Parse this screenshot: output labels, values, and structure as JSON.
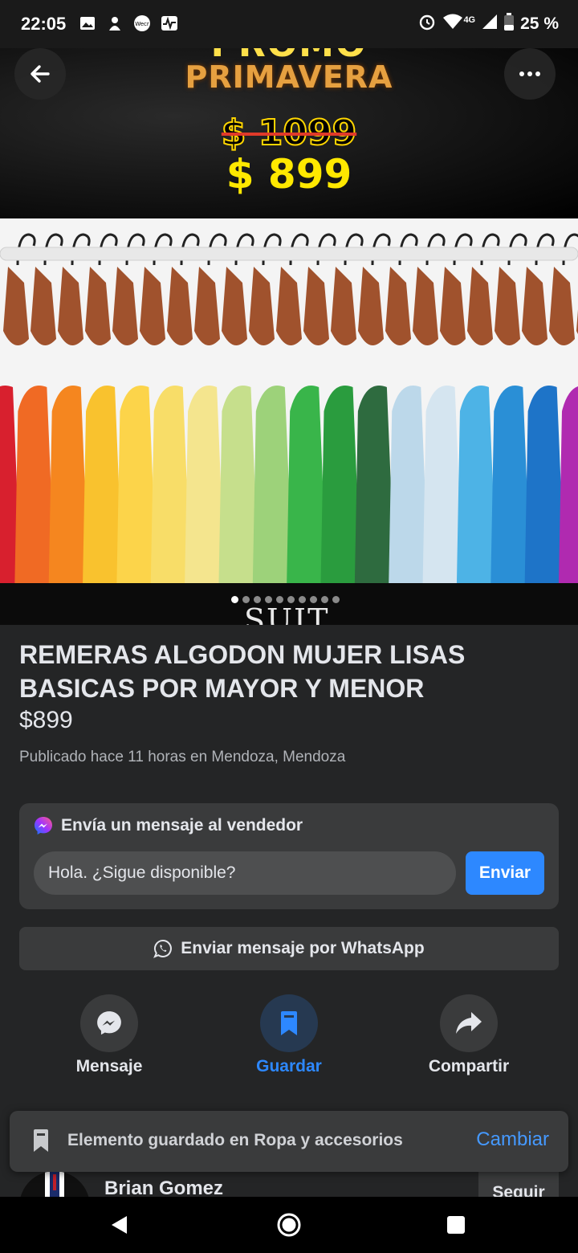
{
  "status_bar": {
    "time": "22:05",
    "network": "4G",
    "battery": "25 %",
    "icons": [
      "gallery-icon",
      "app-icon",
      "wecr-icon",
      "activity-icon",
      "alarm-icon",
      "wifi-icon",
      "signal-icon",
      "battery-icon"
    ]
  },
  "hero": {
    "promo_top": "PROMO",
    "promo_main": "PRIMAVERA",
    "old_price": "$ 1099",
    "new_price": "$ 899"
  },
  "gallery": {
    "dots_total": 10,
    "active_index": 0,
    "next_image_text": "SUIT"
  },
  "listing": {
    "title": "REMERAS ALGODON MUJER LISAS BASICAS POR MAYOR Y MENOR",
    "price": "$899",
    "meta": "Publicado hace 11 horas en Mendoza, Mendoza"
  },
  "message_card": {
    "header": "Envía un mensaje al vendedor",
    "input_value": "Hola. ¿Sigue disponible?",
    "send_label": "Enviar"
  },
  "whatsapp": {
    "label": "Enviar mensaje por WhatsApp"
  },
  "actions": [
    {
      "label": "Mensaje",
      "icon": "messenger-icon",
      "active": false
    },
    {
      "label": "Guardar",
      "icon": "bookmark-icon",
      "active": true
    },
    {
      "label": "Compartir",
      "icon": "share-icon",
      "active": false
    }
  ],
  "toast": {
    "text": "Elemento guardado en Ropa y accesorios",
    "action": "Cambiar"
  },
  "seller": {
    "name": "Brian Gomez",
    "follow_label": "Seguir"
  },
  "colors": {
    "accent": "#2d88ff",
    "background": "#242526",
    "card": "#3a3b3c",
    "price_yellow": "#ffe800"
  }
}
